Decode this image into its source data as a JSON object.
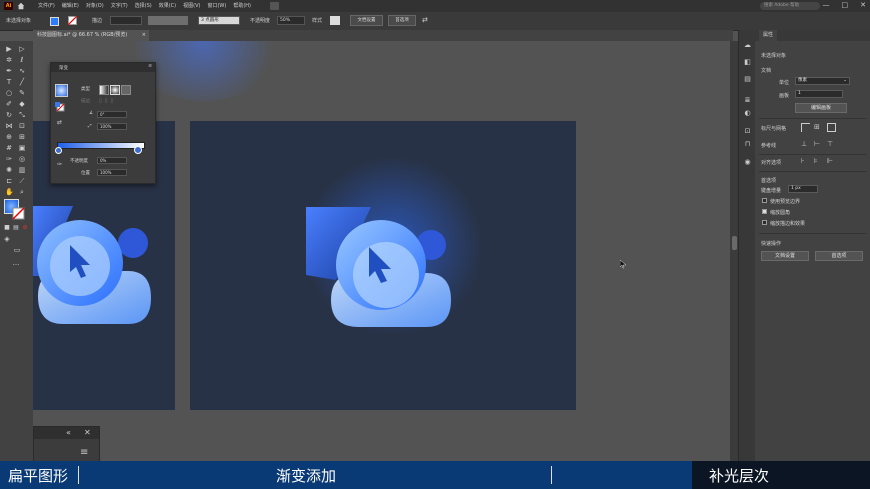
{
  "menubar": {
    "app_logo": "Ai",
    "items": [
      "文件(F)",
      "编辑(E)",
      "对象(O)",
      "文字(T)",
      "选择(S)",
      "效果(C)",
      "视图(V)",
      "窗口(W)",
      "帮助(H)"
    ],
    "search_placeholder": "搜索 Adobe 帮助",
    "window_controls": [
      "—",
      "□",
      "✕"
    ]
  },
  "controlbar": {
    "selection_label": "未选择对象",
    "stroke_label": "描边",
    "stroke_value": "",
    "brush_value": "3 点圆形",
    "opacity_label": "不透明度",
    "opacity_value": "50%",
    "style_label": "样式",
    "doc_setup": "文档设置",
    "prefs": "首选项"
  },
  "tab": {
    "title": "科技圆图标.ai* @ 66.67 % (RGB/预览)",
    "close": "×"
  },
  "gradient_panel": {
    "title": "渐变",
    "close": "×",
    "type_label": "类型",
    "stroke_label": "描边",
    "angle_value": "0°",
    "ratio_value": "100%",
    "opacity_label": "不透明度",
    "opacity_value": "0%",
    "location_label": "位置",
    "location_value": "100%"
  },
  "mini_panel": {
    "collapse": "«",
    "close": "✕",
    "menu": "≡"
  },
  "properties": {
    "tab": "属性",
    "no_selection": "未选择对象",
    "document_header": "文档",
    "units_label": "单位",
    "units_value": "像素",
    "artboard_label": "画板",
    "artboard_value": "1",
    "edit_artboard": "编辑画板",
    "ruler_grid_label": "标尺与网格",
    "guides_label": "参考线",
    "snap_label": "对齐选项",
    "prefs_header": "首选项",
    "keyboard_inc_label": "键盘增量",
    "keyboard_inc_value": "1 px",
    "checkbox1": "使用预览边界",
    "checkbox2": "缩放圆角",
    "checkbox3": "缩放描边和效果",
    "quick_actions": "快速操作",
    "doc_setup": "文档设置",
    "prefs": "首选项"
  },
  "captions": [
    "扁平图形",
    "渐变添加",
    "补光层次"
  ],
  "colors": {
    "artboard": "#283246",
    "caption_bar": "#0a3a75",
    "caption_dark": "#0c1524",
    "accent_blue": "#2e7dff"
  }
}
